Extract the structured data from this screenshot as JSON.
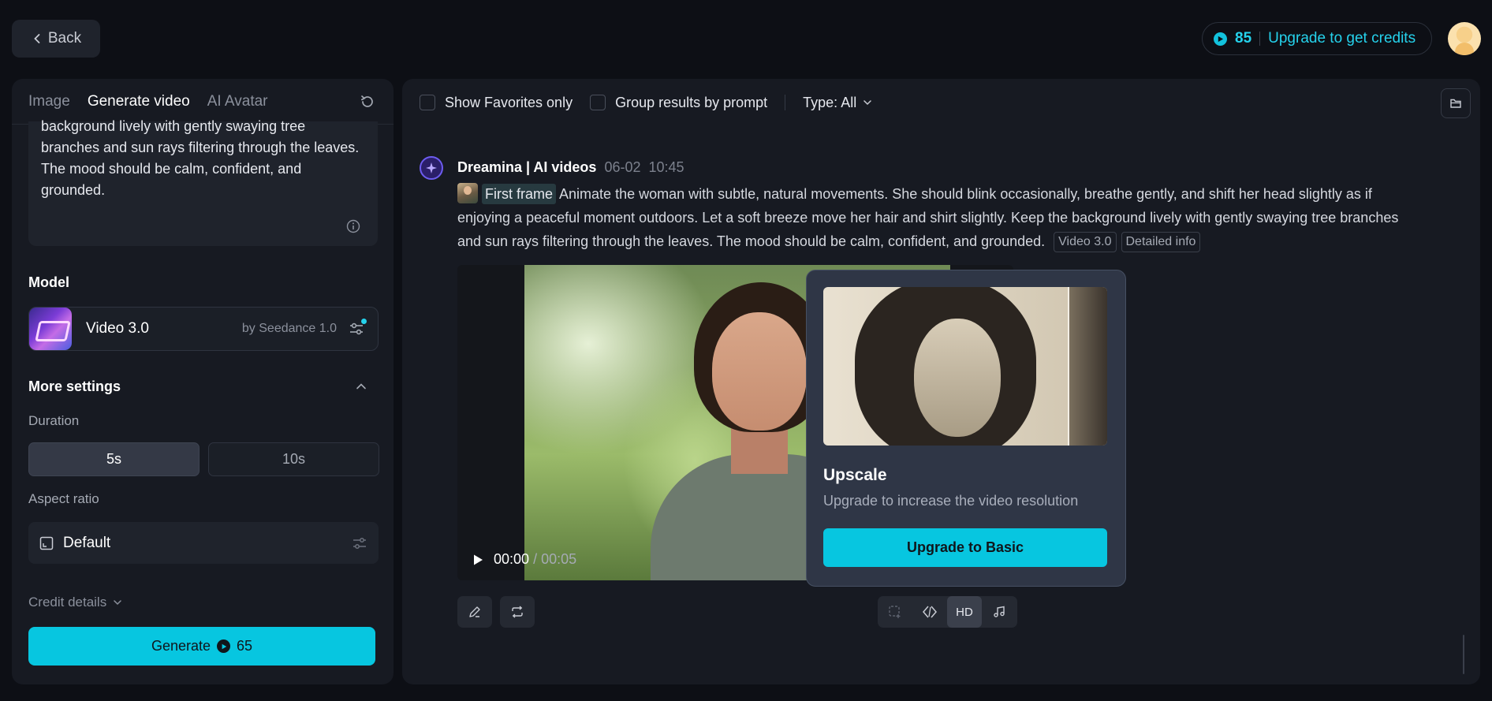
{
  "topbar": {
    "back_label": "Back",
    "credits": "85",
    "upgrade_label": "Upgrade to get credits"
  },
  "left": {
    "tabs": [
      {
        "label": "Image"
      },
      {
        "label": "Generate video"
      },
      {
        "label": "AI Avatar"
      }
    ],
    "prompt_text": "background lively with gently swaying tree branches and sun rays filtering through the leaves. The mood should be calm, confident, and grounded.",
    "model_section": "Model",
    "model_name": "Video 3.0",
    "model_by": "by Seedance 1.0",
    "more_settings": "More settings",
    "duration_label": "Duration",
    "duration_options": [
      "5s",
      "10s"
    ],
    "aspect_label": "Aspect ratio",
    "aspect_value": "Default",
    "credit_details": "Credit details",
    "generate_label": "Generate",
    "generate_cost": "65"
  },
  "right": {
    "filters": {
      "favorites": "Show Favorites only",
      "group": "Group results by prompt",
      "type": "Type: All"
    },
    "message": {
      "author": "Dreamina | AI videos",
      "date": "06-02",
      "time": "10:45",
      "chip": "First frame",
      "text": "Animate the woman with subtle, natural movements. She should blink occasionally, breathe gently, and shift her head slightly as if enjoying a peaceful moment outdoors. Let a soft breeze move her hair and shirt slightly. Keep the background lively with gently swaying tree branches and sun rays filtering through the leaves. The mood should be calm, confident, and grounded.",
      "tag_model": "Video 3.0",
      "tag_info": "Detailed info"
    },
    "video": {
      "current": "00:00",
      "total": "/ 00:05"
    },
    "upscale": {
      "title": "Upscale",
      "desc": "Upgrade to increase the video resolution",
      "button": "Upgrade to Basic"
    },
    "tools": {
      "hd_label": "HD"
    }
  },
  "colors": {
    "accent": "#07c6e0",
    "background": "#0d0f15",
    "panel": "#171a22"
  }
}
